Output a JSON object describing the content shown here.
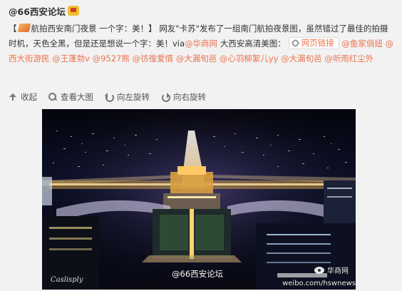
{
  "post": {
    "author": "@66西安论坛",
    "badge_icon": "vip-badge-icon",
    "text": {
      "open_bracket": "【",
      "tag_icon": "tag-icon",
      "headline": "航拍西安南门夜景 一个字：美！】",
      "sentence_part1": "网友\"卡苏\"发布了一组南门航拍夜景图，虽然错过了最佳的拍摄时机，天色全黑，但是还是想说一个字：美！via",
      "via_mention": "@华商网",
      "sentence_part2": " 大西安高清美图：",
      "web_link_label": "网页链接",
      "web_link_icon": "link-icon",
      "mentions": [
        "@鱼家俏妞",
        "@西大街游民",
        "@王蓬勃v",
        "@9527熊",
        "@彷徨爱情",
        "@大漏旬邑",
        "@心羽柳絮儿yy",
        "@大漏旬邑",
        "@听雨红尘外"
      ]
    },
    "toolbar": {
      "collapse": "收起",
      "view_large": "查看大图",
      "rotate_left": "向左旋转",
      "rotate_right": "向右旋转"
    },
    "image": {
      "alt_watermark_left": "Caslisply",
      "watermark_center": "@66西安论坛",
      "watermark_logo_text": "华商网",
      "watermark_url": "weibo.com/hswnews"
    }
  },
  "colors": {
    "link": "#eb7350",
    "background": "#f2f2f2",
    "text": "#333333"
  }
}
